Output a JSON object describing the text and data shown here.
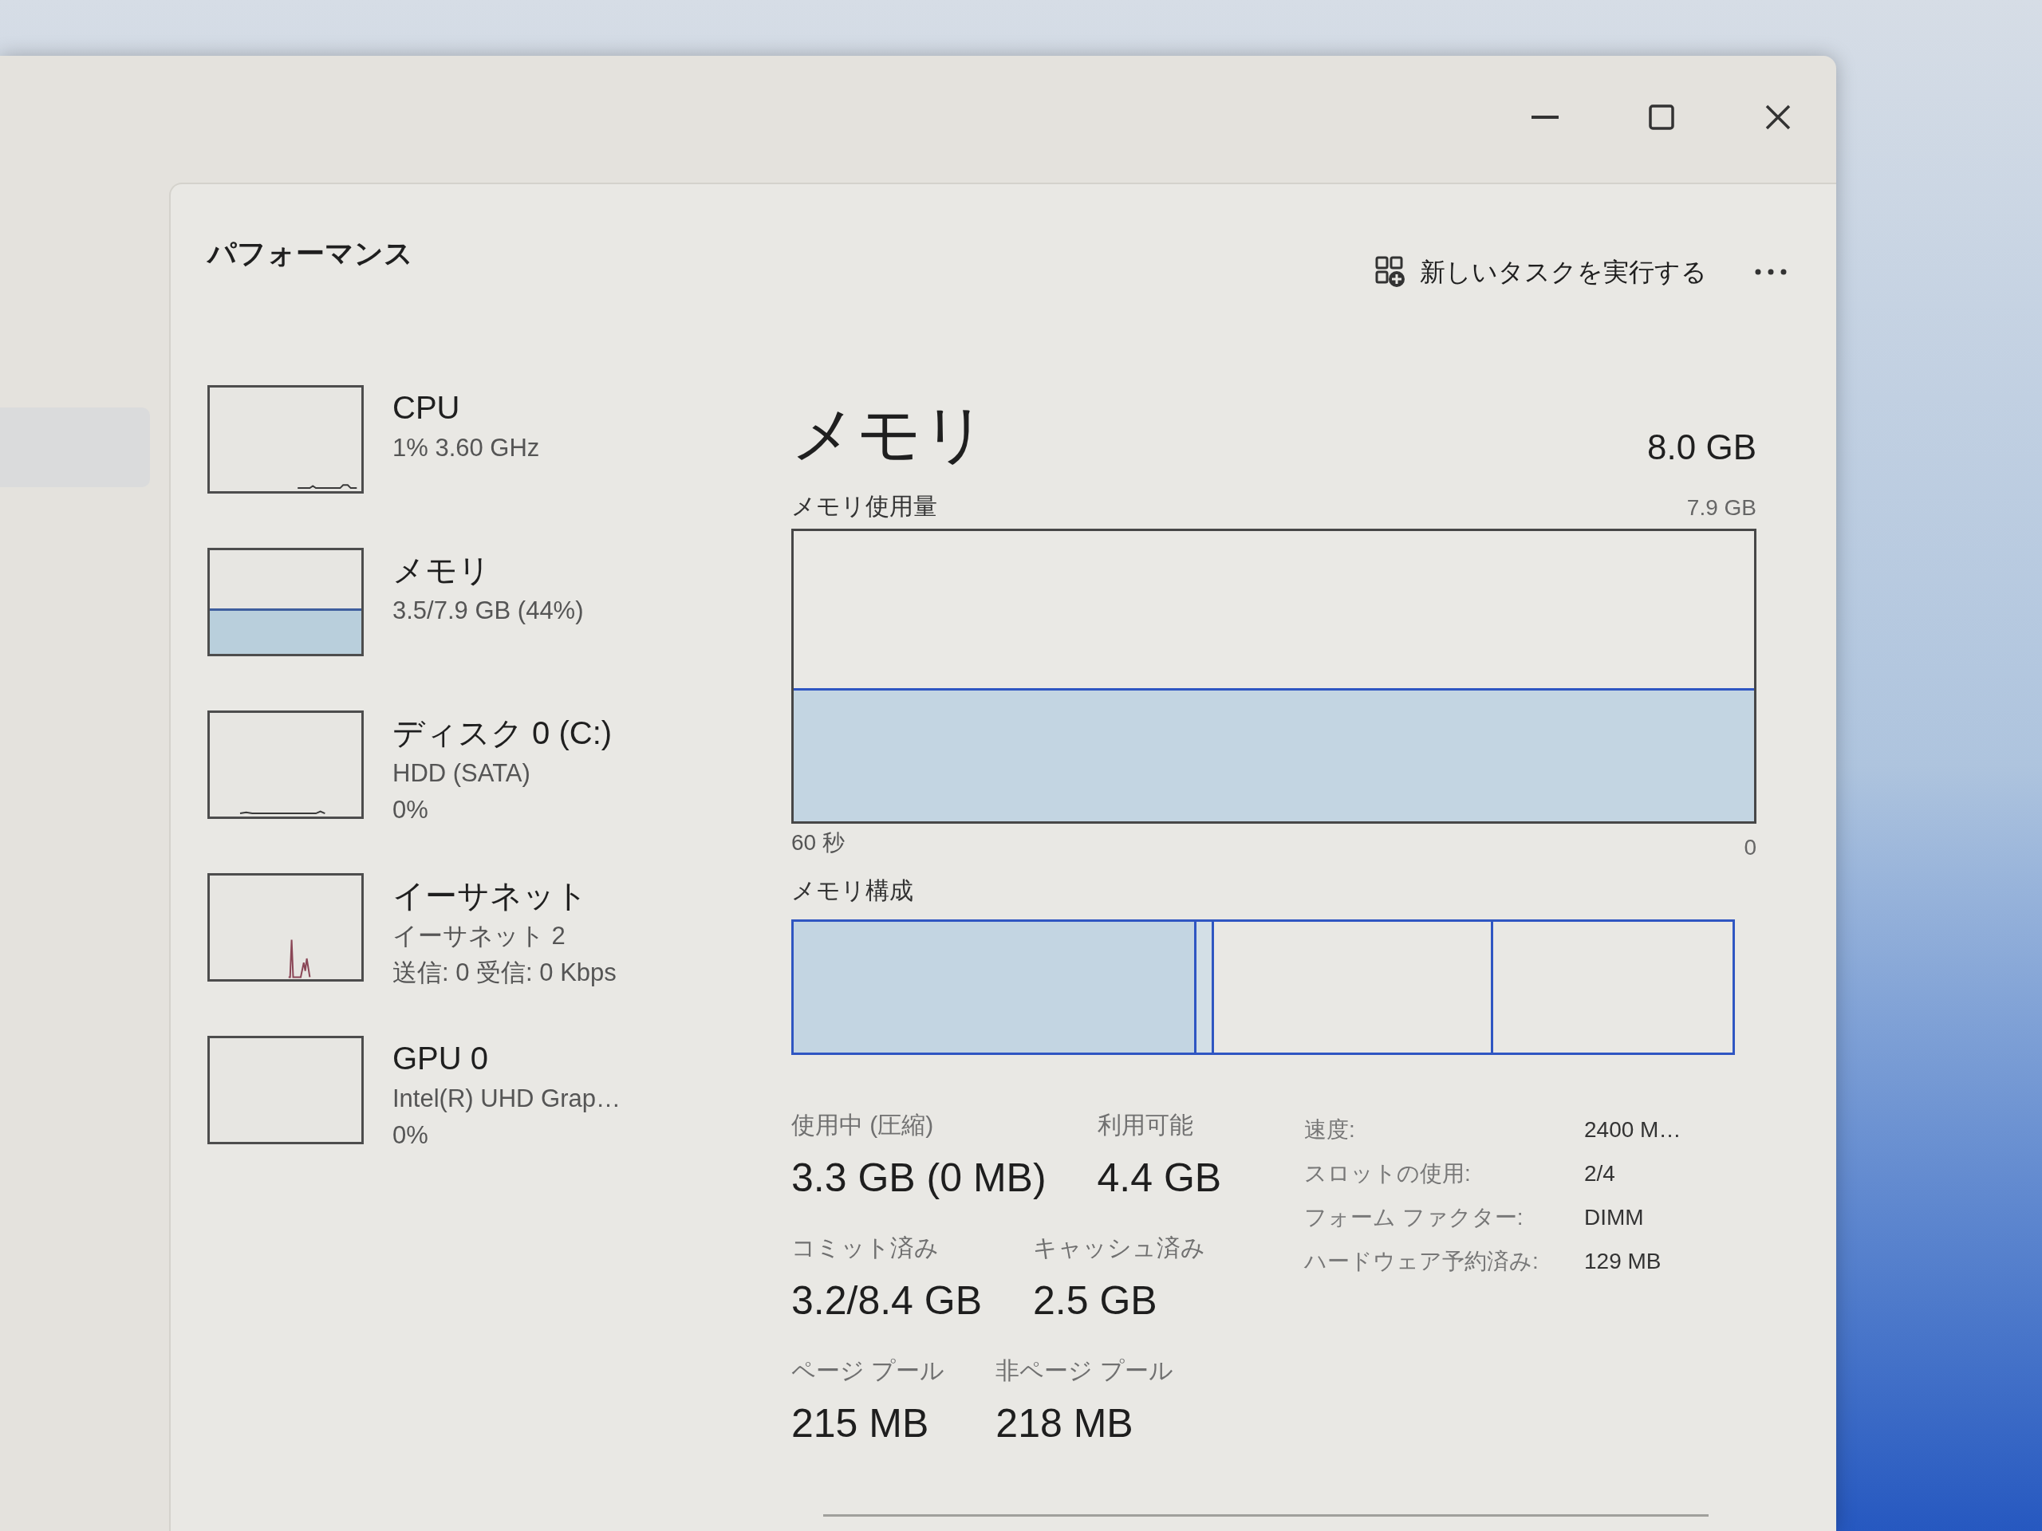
{
  "header": {
    "title": "パフォーマンス",
    "action": "新しいタスクを実行する"
  },
  "sidebar": {
    "items": [
      {
        "kind": "cpu",
        "title": "CPU",
        "details": [
          "1% 3.60 GHz"
        ]
      },
      {
        "kind": "memory",
        "title": "メモリ",
        "details": [
          "3.5/7.9 GB (44%)"
        ]
      },
      {
        "kind": "disk",
        "title": "ディスク 0 (C:)",
        "details": [
          "HDD (SATA)",
          "0%"
        ]
      },
      {
        "kind": "network",
        "title": "イーサネット",
        "details": [
          "イーサネット 2",
          "送信: 0 受信: 0 Kbps"
        ]
      },
      {
        "kind": "gpu",
        "title": "GPU 0",
        "details": [
          "Intel(R) UHD Grap…",
          "0%"
        ]
      }
    ]
  },
  "main": {
    "title": "メモリ",
    "capacity": "8.0 GB",
    "usage_graph": {
      "label": "メモリ使用量",
      "max": "7.9 GB",
      "time_start": "60 秒",
      "time_end": "0"
    },
    "composition": {
      "label": "メモリ構成"
    },
    "stat_rows": [
      [
        {
          "label": "使用中 (圧縮)",
          "value": "3.3 GB (0 MB)"
        },
        {
          "label": "利用可能",
          "value": "4.4 GB"
        }
      ],
      [
        {
          "label": "コミット済み",
          "value": "3.2/8.4 GB"
        },
        {
          "label": "キャッシュ済み",
          "value": "2.5 GB"
        }
      ],
      [
        {
          "label": "ページ プール",
          "value": "215 MB"
        },
        {
          "label": "非ページ プール",
          "value": "218 MB"
        }
      ]
    ],
    "details": [
      {
        "label": "速度:",
        "value": "2400 M…"
      },
      {
        "label": "スロットの使用:",
        "value": "2/4"
      },
      {
        "label": "フォーム ファクター:",
        "value": "DIMM"
      },
      {
        "label": "ハードウェア予約済み:",
        "value": "129 MB"
      }
    ]
  }
}
